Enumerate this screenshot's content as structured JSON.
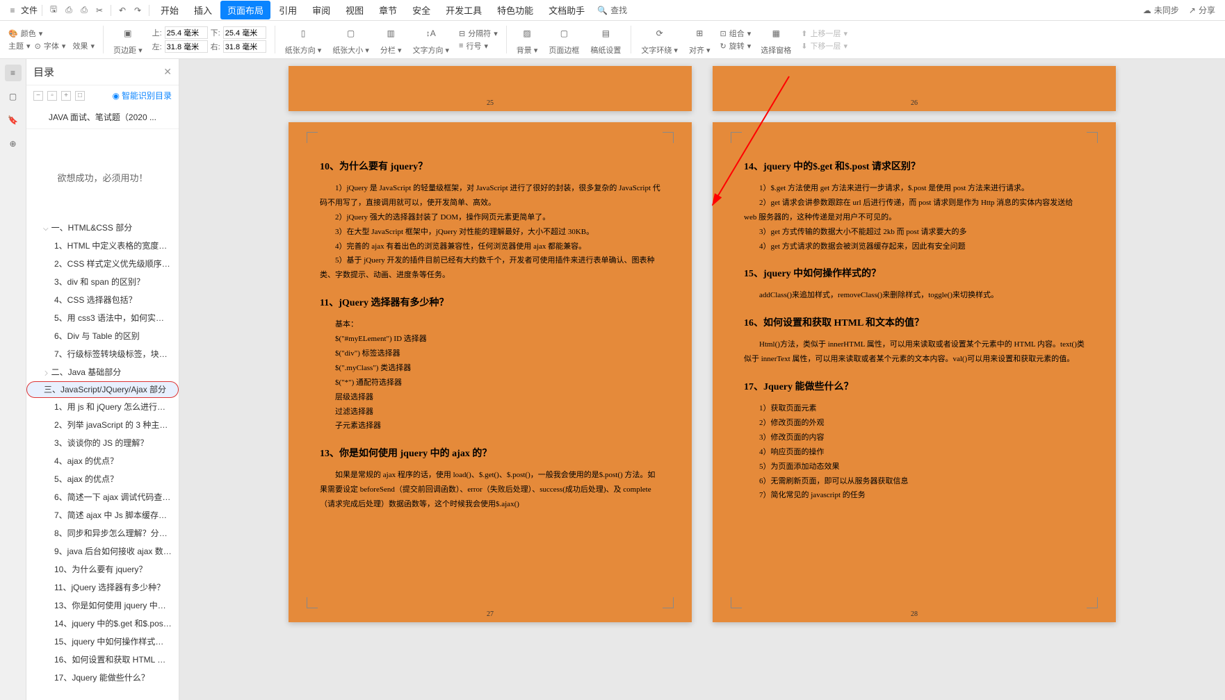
{
  "menubar": {
    "file": "文件",
    "tabs": [
      "开始",
      "插入",
      "页面布局",
      "引用",
      "审阅",
      "视图",
      "章节",
      "安全",
      "开发工具",
      "特色功能",
      "文档助手"
    ],
    "active_tab_index": 2,
    "search": "查找",
    "unsync": "未同步",
    "share": "分享"
  },
  "ribbon": {
    "theme_group": {
      "color": "颜色",
      "theme": "主题",
      "font": "字体",
      "effect": "效果"
    },
    "margins": {
      "label": "页边距",
      "top": "上:",
      "top_val": "25.4 毫米",
      "left": "左:",
      "left_val": "31.8 毫米",
      "bottom": "下:",
      "bottom_val": "25.4 毫米",
      "right": "右:",
      "right_val": "31.8 毫米"
    },
    "orient": "纸张方向",
    "size": "纸张大小",
    "columns": "分栏",
    "textdir": "文字方向",
    "lineno": "行号",
    "breaks": "分隔符",
    "bg": "背景",
    "border": "页面边框",
    "draft": "稿纸设置",
    "wrap": "文字环绕",
    "align": "对齐",
    "group": "组合",
    "rotate": "旋转",
    "pane": "选择窗格",
    "moveup": "上移一层",
    "movedown": "下移一层"
  },
  "sidebar": {
    "title": "目录",
    "smart": "智能识别目录",
    "doc_title": "JAVA 面试、笔试题（2020 ...",
    "motto": "欲想成功，必须用功！",
    "sections": {
      "s1": {
        "label": "一、HTML&CSS 部分",
        "items": [
          "1、HTML 中定义表格的宽度用 8...",
          "2、CSS 样式定义优先级顺序是？",
          "3、div 和 span 的区别？",
          "4、CSS 选择器包括？",
          "5、用 css3 语法中，如何实现一...",
          "6、Div 与 Table 的区别",
          "7、行级标签转块级标签，块级标..."
        ]
      },
      "s2": {
        "label": "二、Java 基础部分"
      },
      "s3": {
        "label": "三、JavaScript/JQuery/Ajax 部分",
        "items": [
          "1、用 js 和 jQuery 怎么进行表单...",
          "2、列举 javaScript 的 3 种主要数...",
          "3、谈谈你的 JS 的理解？",
          "4、ajax 的优点？",
          "5、ajax 的优点？",
          "6、简述一下 ajax 调试代码查找...",
          "7、简述 ajax 中 Js 脚本缓存问题...",
          "8、同步和异步怎么理解？分别在...",
          "9、java 后台如何接收 ajax 数据...",
          "10、为什么要有 jquery？",
          "11、jQuery 选择器有多少种？",
          "13、你是如何使用 jquery 中的 aj...",
          "14、jquery 中的$.get 和$.post ...",
          "15、jquery 中如何操作样式的？",
          "16、如何设置和获取 HTML 和文...",
          "17、Jquery 能做些什么？"
        ]
      }
    }
  },
  "pages": {
    "p25_num": "25",
    "p26_num": "26",
    "p27_num": "27",
    "p28_num": "28",
    "left": {
      "h10": "10、为什么要有 jquery？",
      "p10": [
        "1）jQuery 是 JavaScript 的轻量级框架，对 JavaScript 进行了很好的封装，很多复杂的 JavaScript 代码不用写了，直接调用就可以，使开发简单、高效。",
        "2）jQuery 强大的选择器封装了 DOM，操作网页元素更简单了。",
        "3）在大型 JavaScript 框架中，jQuery 对性能的理解最好，大小不超过 30KB。",
        "4）完善的 ajax 有着出色的浏览器兼容性，任何浏览器使用 ajax 都能兼容。",
        "5）基于 jQuery 开发的插件目前已经有大约数千个，开发者可使用插件来进行表单确认、图表种类、字数提示、动画、进度条等任务。"
      ],
      "h11": "11、jQuery 选择器有多少种？",
      "b11": "基本：",
      "sel": [
        "$(\"#myELement\")   ID 选择器",
        "$(\"div\")            标签选择器",
        "$(\".myClass\")      类选择器",
        "$(\"*\")              通配符选择器",
        "层级选择器",
        "过滤选择器",
        "子元素选择器"
      ],
      "h13": "13、你是如何使用 jquery 中的 ajax 的？",
      "p13": "如果是常规的 ajax 程序的话，使用 load()、$.get()、$.post()，一般我会使用的是$.post() 方法。如果需要设定 beforeSend（提交前回调函数）、error（失败后处理）、success(成功后处理)、及 complete（请求完成后处理）数据函数等，这个时候我会使用$.ajax()"
    },
    "right": {
      "h14": "14、jquery 中的$.get 和$.post 请求区别？",
      "p14": [
        "1）$.get 方法使用 get 方法来进行一步请求，$.post 是使用 post 方法来进行请求。",
        "2）get 请求会讲参数跟踪在 url 后进行传递，而 post 请求则是作为 Http 消息的实体内容发送给 web 服务器的，这种传递是对用户不可见的。",
        "3）get 方式传输的数据大小不能超过 2kb 而 post 请求要大的多",
        "4）get 方式请求的数据会被浏览器缓存起来，因此有安全问题"
      ],
      "h15": "15、jquery 中如何操作样式的？",
      "p15": "addClass()来追加样式，removeClass()来删除样式，toggle()来切换样式。",
      "h16": "16、如何设置和获取 HTML 和文本的值？",
      "p16": "Html()方法，类似于 innerHTML 属性，可以用来读取或者设置某个元素中的 HTML 内容。text()类似于 innerText 属性，可以用来读取或者某个元素的文本内容。val()可以用来设置和获取元素的值。",
      "h17": "17、Jquery 能做些什么？",
      "p17": [
        "1）获取页面元素",
        "2）修改页面的外观",
        "3）修改页面的内容",
        "4）响应页面的操作",
        "5）为页面添加动态效果",
        "6）无需刷新页面，即可以从服务器获取信息",
        "7）简化常见的 javascript 的任务"
      ]
    }
  }
}
